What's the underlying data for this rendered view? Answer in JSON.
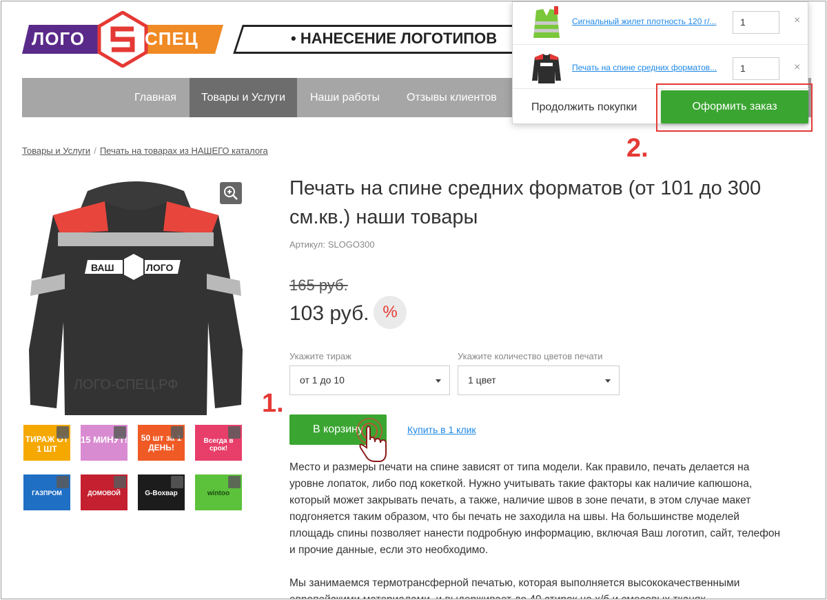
{
  "header": {
    "logo_left": "ЛОГО",
    "logo_right": "СПЕЦ",
    "banner": "• НАНЕСЕНИЕ ЛОГОТИПОВ"
  },
  "nav": {
    "items": [
      {
        "label": "Главная",
        "active": false
      },
      {
        "label": "Товары и Услуги",
        "active": true
      },
      {
        "label": "Наши работы",
        "active": false
      },
      {
        "label": "Отзывы клиентов",
        "active": false
      }
    ]
  },
  "breadcrumb": {
    "items": [
      "Товары и Услуги",
      "Печать на товарах из НАШЕГО каталога"
    ],
    "separator": "/"
  },
  "product": {
    "title": "Печать на спине средних форматов (от 101 до 300 см.кв.) наши товары",
    "sku": "Артикул: SLOGO300",
    "old_price": "165 руб.",
    "price": "103 руб.",
    "discount_symbol": "%",
    "image_text": {
      "left": "ВАШ",
      "right": "ЛОГО",
      "watermark": "ЛОГО-СПЕЦ.РФ"
    },
    "thumbnails": [
      {
        "text": "ТИРАЖ ОТ 1 ШТ"
      },
      {
        "text": "15 МИНУТ!"
      },
      {
        "text": "50 шт за 1 ДЕНЬ!"
      },
      {
        "text": "Всегда в срок!"
      },
      {
        "text": "ГАЗПРОМ"
      },
      {
        "text": "ДОМОВОЙ"
      },
      {
        "text": "G-Вохвар"
      },
      {
        "text": "wintoo"
      }
    ]
  },
  "options": {
    "run_label": "Укажите тираж",
    "run_value": "от 1 до 10",
    "colors_label": "Укажите количество цветов печати",
    "colors_value": "1 цвет"
  },
  "actions": {
    "cart": "В корзину",
    "buy_one_click": "Купить в 1 клик"
  },
  "annotations": {
    "step1": "1.",
    "step2": "2."
  },
  "description": [
    "Место и размеры печати на спине зависят от типа модели. Как правило, печать делается на уровне лопаток, либо под кокеткой. Нужно учитывать такие факторы как наличие капюшона, который может закрывать печать, а также, наличие швов в зоне печати, в этом случае макет подгоняется таким образом, что бы печать не заходила на швы. На большинстве моделей площадь спины позволяет нанести подробную информацию, включая Ваш логотип, сайт, телефон и прочие данные, если это необходимо.",
    "Мы занимаемся термотрансферной печатью, которая выполняется высококачественными европейскими материалами, и выдерживает до 40 стирок на х/б и смесовых тканях."
  ],
  "cart_popup": {
    "items": [
      {
        "name": "Сигнальный жилет плотность 120 г/...",
        "qty": "1",
        "remove": "×"
      },
      {
        "name": "Печать на спине средних форматов...",
        "qty": "1",
        "remove": "×"
      }
    ],
    "continue": "Продолжить покупки",
    "checkout": "Оформить заказ"
  },
  "colors": {
    "green": "#3aa531",
    "red": "#e53935",
    "link": "#1e88e5",
    "logo_purple": "#5a2a8a",
    "logo_orange": "#f08a24"
  }
}
